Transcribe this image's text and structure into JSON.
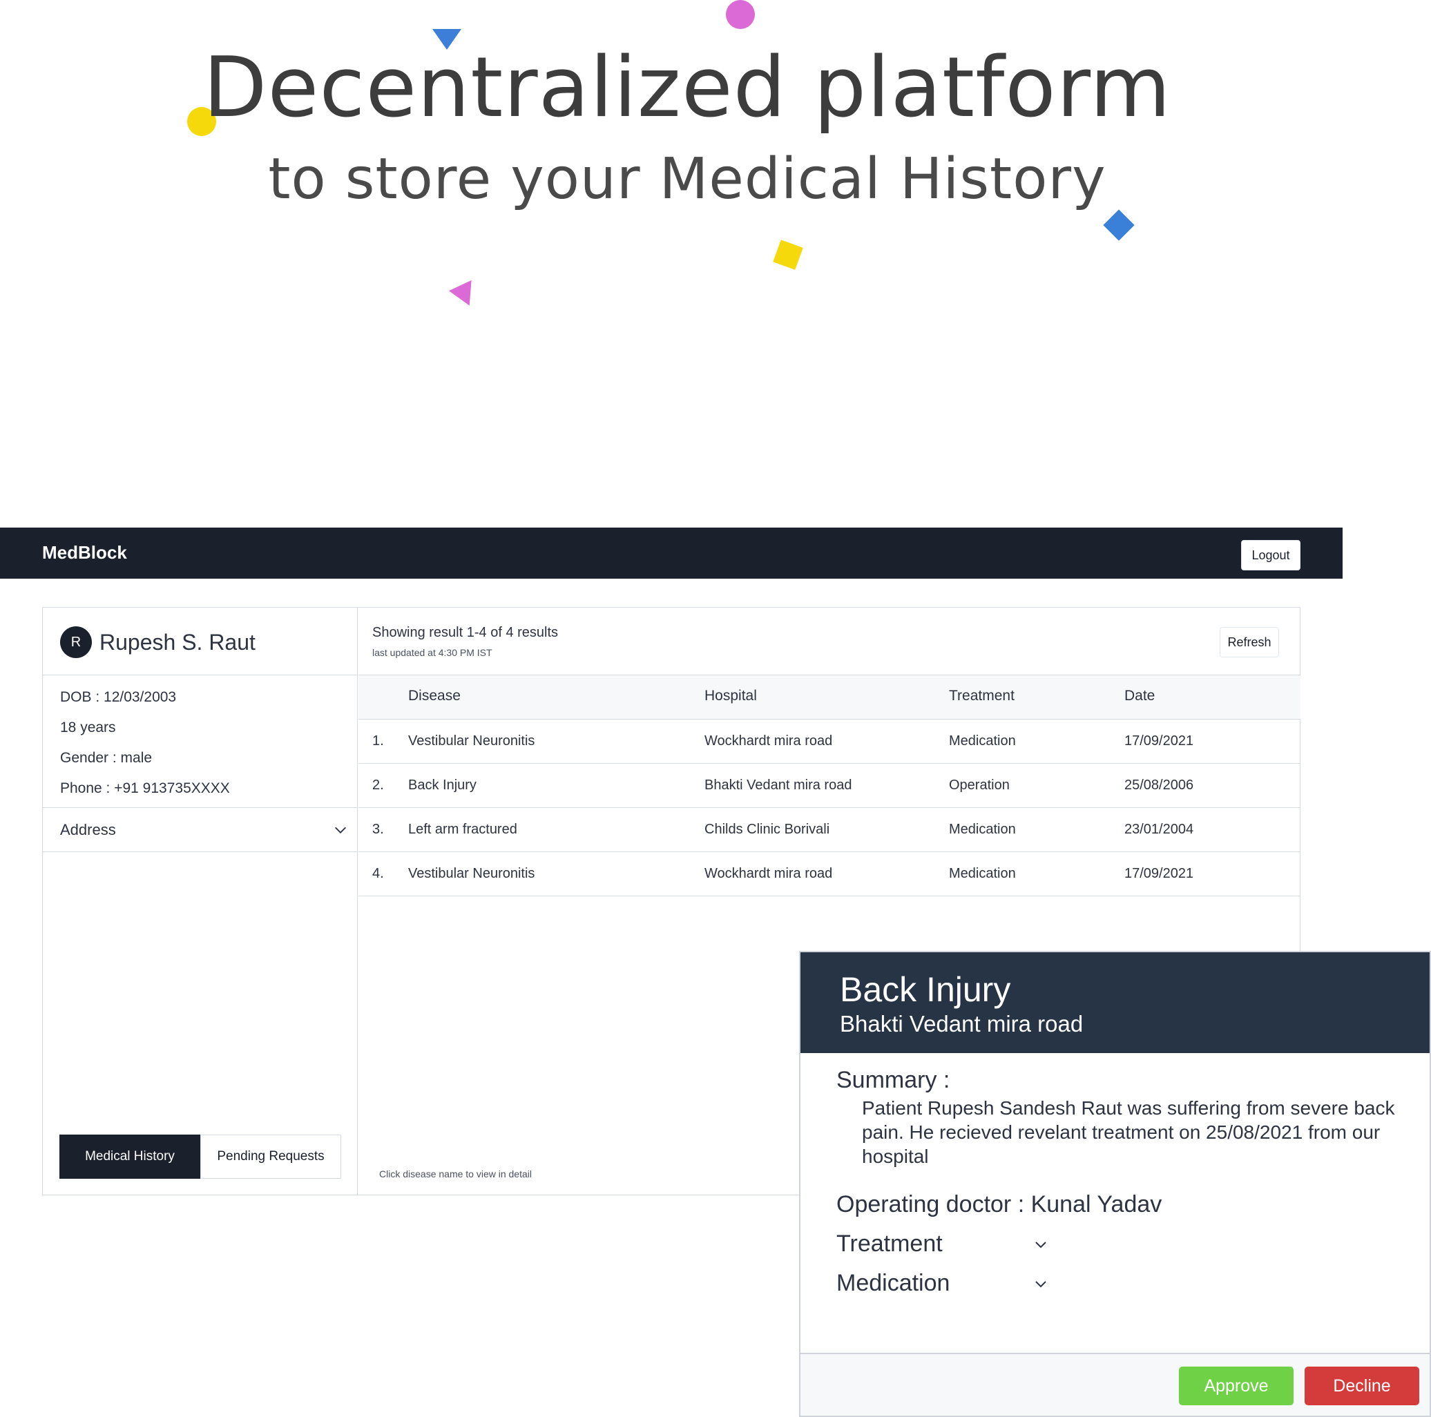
{
  "hero": {
    "title": "Decentralized platform",
    "subtitle": "to store your Medical History",
    "colors": {
      "yellow": "#f5d90a",
      "pink": "#db6ad6",
      "blue": "#3d7fd8"
    }
  },
  "navbar": {
    "brand": "MedBlock",
    "logout_label": "Logout",
    "background": "#1a202c"
  },
  "profile": {
    "avatar_initial": "R",
    "name": "Rupesh S. Raut",
    "dob": "DOB : 12/03/2003",
    "age": "18 years",
    "gender": "Gender : male",
    "phone": "Phone : +91 913735XXXX",
    "address_label": "Address"
  },
  "tabs": {
    "active": "Medical History",
    "inactive": "Pending Requests"
  },
  "results": {
    "count_text": "Showing result 1-4 of 4 results",
    "updated_text": "last updated at 4:30 PM IST",
    "refresh_label": "Refresh",
    "hint": "Click disease name to view in detail",
    "columns": [
      "Disease",
      "Hospital",
      "Treatment",
      "Date"
    ],
    "rows": [
      {
        "num": "1.",
        "disease": "Vestibular Neuronitis",
        "hospital": "Wockhardt mira road",
        "treatment": "Medication",
        "date": "17/09/2021"
      },
      {
        "num": "2.",
        "disease": "Back Injury",
        "hospital": "Bhakti Vedant mira road",
        "treatment": "Operation",
        "date": "25/08/2006"
      },
      {
        "num": "3.",
        "disease": "Left arm fractured",
        "hospital": "Childs Clinic Borivali",
        "treatment": "Medication",
        "date": "23/01/2004"
      },
      {
        "num": "4.",
        "disease": "Vestibular Neuronitis",
        "hospital": "Wockhardt mira road",
        "treatment": "Medication",
        "date": "17/09/2021"
      }
    ]
  },
  "modal": {
    "title": "Back Injury",
    "hospital": "Bhakti Vedant mira road",
    "summary_label": "Summary :",
    "summary_text": "Patient Rupesh Sandesh Raut was suffering from severe back pain. He recieved revelant treatment on 25/08/2021 from our hospital",
    "doctor_line": "Operating doctor : Kunal Yadav",
    "treatment_label": "Treatment",
    "medication_label": "Medication",
    "approve_label": "Approve",
    "decline_label": "Decline",
    "approve_color": "#6ed146",
    "decline_color": "#d43b3b"
  }
}
